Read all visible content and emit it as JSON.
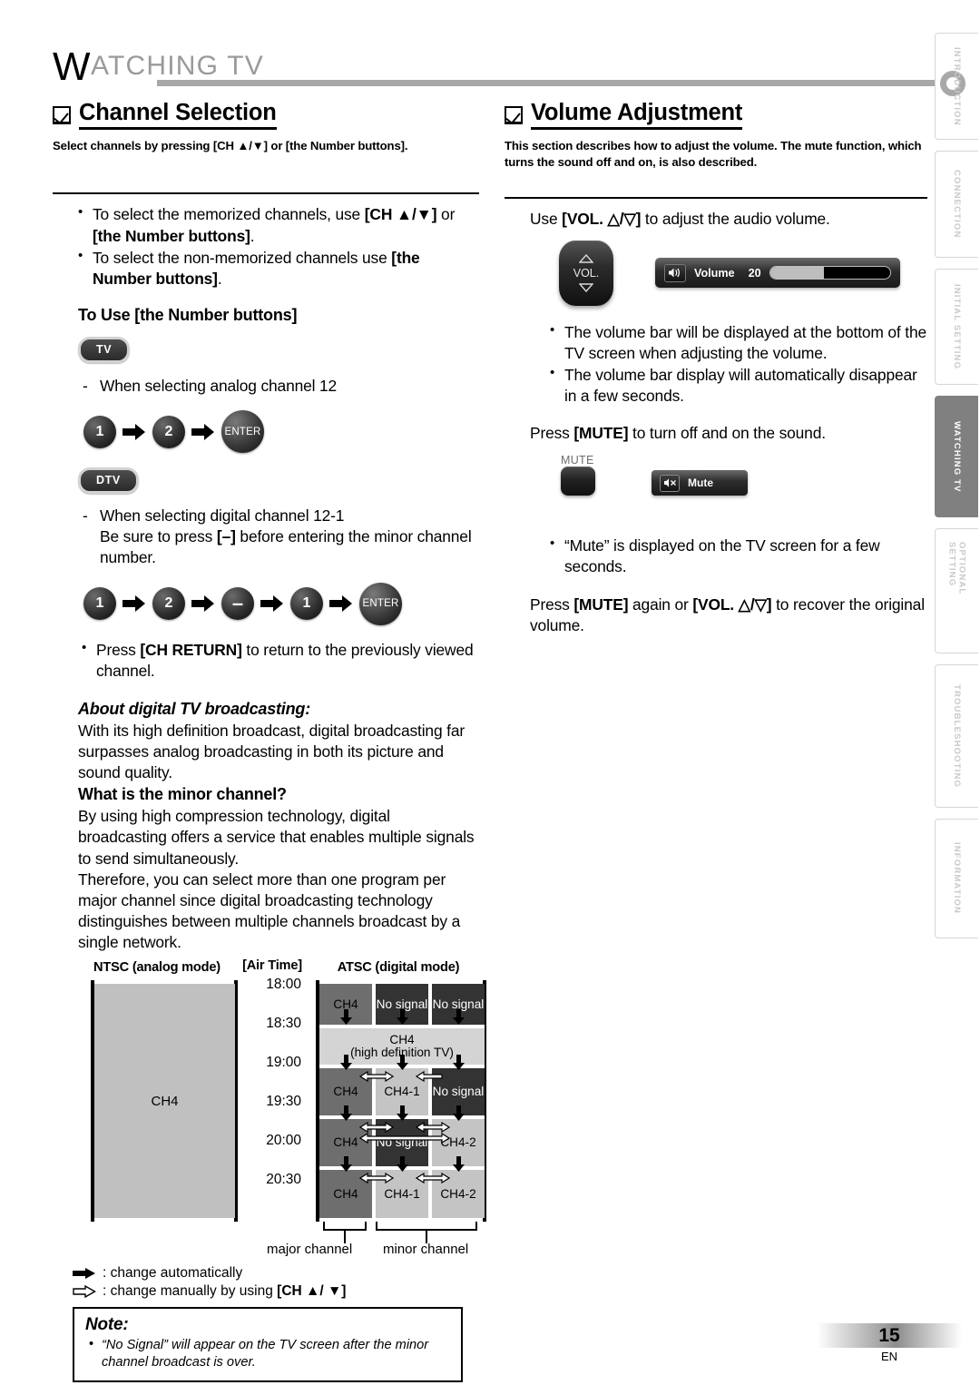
{
  "header": {
    "title_cap": "W",
    "title_rest": "ATCHING TV"
  },
  "left": {
    "section_title": "Channel Selection",
    "section_sub": "Select channels by pressing [CH ▲/▼] or [the Number buttons].",
    "bullets": [
      "To select the memorized channels, use [CH ▲/▼] or [the Number buttons].",
      "To select the non-memorized channels use [the Number buttons]."
    ],
    "sub_head": "To Use [the Number buttons]",
    "badge_tv": "TV",
    "badge_dtv": "DTV",
    "analog_line": "When selecting analog channel 12",
    "analog_seq": [
      "1",
      "2",
      "ENTER"
    ],
    "digital_line1": "When selecting digital channel 12-1",
    "digital_line2": "Be sure to press [–] before entering the minor channel number.",
    "digital_seq": [
      "1",
      "2",
      "–",
      "1",
      "ENTER"
    ],
    "ch_return_bullet": "Press [CH RETURN] to return to the previously viewed channel.",
    "about_head": "About digital TV broadcasting:",
    "about_body": "With its high definition broadcast, digital broadcasting far surpasses analog broadcasting in both its picture and sound quality.",
    "minor_head": "What is the minor channel?",
    "minor_body1": "By using high compression technology, digital broadcasting offers a service that enables multiple signals to send simultaneously.",
    "minor_body2": "Therefore, you can select more than one program per major channel since digital broadcasting technology distinguishes between multiple channels broadcast by a single network.",
    "legend_auto": ": change automatically",
    "legend_manual": ": change manually by using [CH ▲/ ▼]",
    "note_title": "Note:",
    "note_item": "“No Signal” will appear on the TV screen after the minor channel broadcast is over."
  },
  "diagram": {
    "ntsc_head": "NTSC (analog mode)",
    "airtime_head": "[Air Time]",
    "atsc_head": "ATSC (digital mode)",
    "ntsc_cell": "CH4",
    "times": [
      "18:00",
      "18:30",
      "19:00",
      "19:30",
      "20:00",
      "20:30"
    ],
    "rows": [
      {
        "time": "18:00",
        "cells": [
          {
            "label": "CH4",
            "tone": "mid"
          },
          {
            "label": "No signal",
            "tone": "dark"
          },
          {
            "label": "No signal",
            "tone": "dark"
          }
        ]
      },
      {
        "time": "18:30",
        "cells": [
          {
            "label": "CH4\n(high definition TV)",
            "tone": "hd",
            "span": 3
          }
        ]
      },
      {
        "time": "19:00",
        "cells": [
          {
            "label": "CH4",
            "tone": "mid"
          },
          {
            "label": "CH4-1",
            "tone": "light"
          },
          {
            "label": "No signal",
            "tone": "dark"
          }
        ]
      },
      {
        "time": "19:30",
        "cells": [
          {
            "label": "CH4",
            "tone": "mid"
          },
          {
            "label": "No signal",
            "tone": "dark"
          },
          {
            "label": "CH4-2",
            "tone": "light"
          }
        ]
      },
      {
        "time": "20:00",
        "cells": [
          {
            "label": "CH4",
            "tone": "mid"
          },
          {
            "label": "CH4-1",
            "tone": "light"
          },
          {
            "label": "CH4-2",
            "tone": "light"
          }
        ]
      }
    ],
    "brace_major": "major channel",
    "brace_minor": "minor channel"
  },
  "right": {
    "section_title": "Volume Adjustment",
    "section_sub": "This section describes how to adjust the volume. The mute function, which turns the sound off and on, is also described.",
    "use_vol_line": "Use [VOL. △/▽] to adjust the audio volume.",
    "vol_button_label": "VOL.",
    "volume_osd": {
      "label": "Volume",
      "value": "20",
      "fill_percent": 45
    },
    "vol_bullets": [
      "The volume bar will be displayed at the bottom of the TV screen when adjusting the volume.",
      "The volume bar display will automatically disappear in a few seconds."
    ],
    "mute_line": "Press [MUTE] to turn off and on the sound.",
    "mute_button_label": "MUTE",
    "mute_osd_label": "Mute",
    "mute_bullet": "“Mute” is displayed on the TV screen for a few seconds.",
    "recover_line": "Press [MUTE] again or [VOL. △/▽] to recover the original volume."
  },
  "tabs": [
    {
      "label": "INTRODUCTION",
      "active": false
    },
    {
      "label": "CONNECTION",
      "active": false
    },
    {
      "label": "INITIAL  SETTING",
      "active": false
    },
    {
      "label": "WATCHING TV",
      "active": true
    },
    {
      "label": "OPTIONAL  SETTING",
      "active": false
    },
    {
      "label": "TROUBLESHOOTING",
      "active": false
    },
    {
      "label": "INFORMATION",
      "active": false
    }
  ],
  "footer": {
    "page_number": "15",
    "lang": "EN"
  },
  "colors": {
    "accent_gray": "#a8a8a8",
    "tab_active": "#808080"
  }
}
